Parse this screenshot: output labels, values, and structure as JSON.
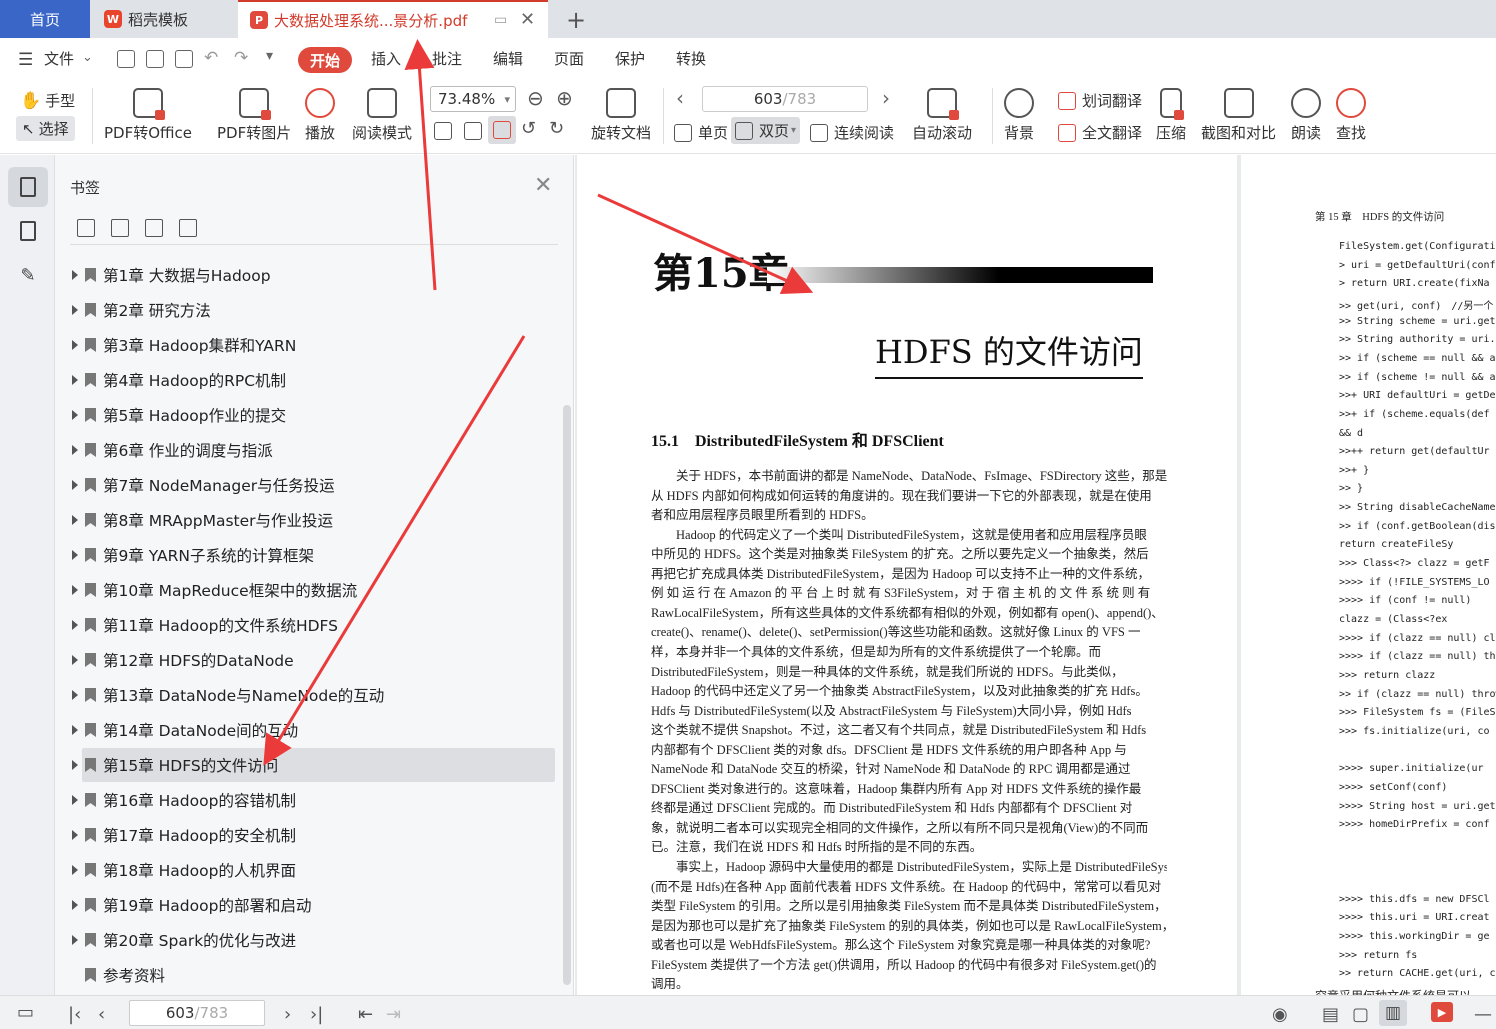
{
  "tabs": {
    "home": "首页",
    "wps": "稻壳模板",
    "pdf": "大数据处理系统...景分析.pdf"
  },
  "menu": {
    "file": "文件",
    "items": [
      "开始",
      "插入",
      "批注",
      "编辑",
      "页面",
      "保护",
      "转换"
    ]
  },
  "toolbar": {
    "hand": "手型",
    "select": "选择",
    "pdf_to_office": "PDF转Office",
    "pdf_to_image": "PDF转图片",
    "play": "播放",
    "read_mode": "阅读模式",
    "zoom": "73.48%",
    "rotate": "旋转文档",
    "page_current": "603",
    "page_total": "/783",
    "single": "单页",
    "double": "双页",
    "continuous": "连续阅读",
    "auto_scroll": "自动滚动",
    "background": "背景",
    "word_translate": "划词翻译",
    "full_translate": "全文翻译",
    "compress": "压缩",
    "screenshot": "截图和对比",
    "read_aloud": "朗读",
    "find": "查找"
  },
  "bookmarks": {
    "title": "书签",
    "items": [
      "第1章 大数据与Hadoop",
      "第2章 研究方法",
      "第3章 Hadoop集群和YARN",
      "第4章 Hadoop的RPC机制",
      "第5章 Hadoop作业的提交",
      "第6章 作业的调度与指派",
      "第7章 NodeManager与任务投运",
      "第8章 MRAppMaster与作业投运",
      "第9章 YARN子系统的计算框架",
      "第10章 MapReduce框架中的数据流",
      "第11章 Hadoop的文件系统HDFS",
      "第12章 HDFS的DataNode",
      "第13章 DataNode与NameNode的互动",
      "第14章 DataNode间的互动",
      "第15章 HDFS的文件访问",
      "第16章 Hadoop的容错机制",
      "第17章 Hadoop的安全机制",
      "第18章 Hadoop的人机界面",
      "第19章 Hadoop的部署和启动",
      "第20章 Spark的优化与改进",
      "参考资料"
    ],
    "selected_index": 14
  },
  "page1": {
    "chapter": "第15章",
    "title": "HDFS 的文件访问",
    "section": "15.1　DistributedFileSystem 和 DFSClient",
    "lines": [
      "　　关于 HDFS，本书前面讲的都是 NameNode、DataNode、FsImage、FSDirectory 这些，那是",
      "从 HDFS 内部如何构成如何运转的角度讲的。现在我们要讲一下它的外部表现，就是在使用",
      "者和应用层程序员眼里所看到的 HDFS。",
      "　　Hadoop 的代码定义了一个类叫 DistributedFileSystem，这就是使用者和应用层程序员眼",
      "中所见的 HDFS。这个类是对抽象类 FileSystem 的扩充。之所以要先定义一个抽象类，然后",
      "再把它扩充成具体类 DistributedFileSystem，是因为 Hadoop 可以支持不止一种的文件系统，",
      "例 如 运 行 在 Amazon 的 平 台 上 时 就 有 S3FileSystem，对 于 宿 主 机 的 文 件 系 统 则 有",
      "RawLocalFileSystem，所有这些具体的文件系统都有相似的外观，例如都有 open()、append()、",
      "create()、rename()、delete()、setPermission()等这些功能和函数。这就好像 Linux 的 VFS 一",
      "样，本身并非一个具体的文件系统，但是却为所有的文件系统提供了一个轮廓。而",
      "DistributedFileSystem，则是一种具体的文件系统，就是我们所说的 HDFS。与此类似，",
      "Hadoop 的代码中还定义了另一个抽象类 AbstractFileSystem，以及对此抽象类的扩充 Hdfs。",
      "Hdfs 与 DistributedFileSystem(以及 AbstractFileSystem 与 FileSystem)大同小异，例如 Hdfs",
      "这个类就不提供 Snapshot。不过，这二者又有个共同点，就是 DistributedFileSystem 和 Hdfs",
      "内部都有个 DFSClient 类的对象 dfs。DFSClient 是 HDFS 文件系统的用户即各种 App 与",
      "NameNode 和 DataNode 交互的桥梁，针对 NameNode 和 DataNode 的 RPC 调用都是通过",
      "DFSClient 类对象进行的。这意味着，Hadoop 集群内所有 App 对 HDFS 文件系统的操作最",
      "终都是通过 DFSClient 完成的。而 DistributedFileSystem 和 Hdfs 内部都有个 DFSClient 对",
      "象，就说明二者本可以实现完全相同的文件操作，之所以有所不同只是视角(View)的不同而",
      "已。注意，我们在说 HDFS 和 Hdfs 时所指的是不同的东西。",
      "　　事实上，Hadoop 源码中大量使用的都是 DistributedFileSystem，实际上是 DistributedFileSystem",
      "(而不是 Hdfs)在各种 App 面前代表着 HDFS 文件系统。在 Hadoop 的代码中，常常可以看见对",
      "类型 FileSystem 的引用。之所以是引用抽象类 FileSystem 而不是具体类 DistributedFileSystem，",
      "是因为那也可以是扩充了抽象类 FileSystem 的别的具体类，例如也可以是 RawLocalFileSystem，",
      "或者也可以是 WebHdfsFileSystem。那么这个 FileSystem 对象究竟是哪一种具体类的对象呢?",
      "FileSystem 类提供了一个方法 get()供调用，所以 Hadoop 的代码中有很多对 FileSystem.get()的",
      "调用。"
    ]
  },
  "page2": {
    "header": "第 15 章　HDFS 的文件访问",
    "code": [
      "FileSystem.get(Configuration",
      "> uri = getDefaultUri(conf)",
      "> return URI.create(fixNa",
      ">> get(uri, conf)　//另一个",
      ">> String scheme = uri.getS",
      ">> String authority = uri.g",
      ">> if (scheme == null && au",
      ">> if (scheme != null && aut",
      ">>+ URI defaultUri = getDe",
      ">>+ if (scheme.equals(def",
      "                      && d",
      ">>++ return get(defaultUr",
      ">>+ }",
      ">> }",
      ">> String disableCacheName",
      ">> if (conf.getBoolean(dis",
      "       return createFileSy",
      ">>> Class<?> clazz = getF",
      ">>>> if (!FILE_SYSTEMS_LO",
      ">>>> if (conf != null)",
      "        clazz = (Class<?ex",
      ">>>> if (clazz == null) cl",
      ">>>> if (clazz == null) th",
      ">>> return clazz",
      ">> if (clazz == null) throw",
      ">>> FileSystem fs = (FileSys",
      ">>> fs.initialize(uri, co",
      "",
      ">>>> super.initialize(ur",
      ">>>> setConf(conf)",
      ">>>> String host = uri.get",
      ">>>> homeDirPrefix = conf",
      "",
      "",
      "",
      ">>>> this.dfs = new DFSCl",
      ">>>> this.uri = URI.creat",
      ">>>> this.workingDir = ge",
      ">>> return fs",
      ">> return CACHE.get(uri, co",
      "究竟采用何种文件系统是可以"
    ]
  },
  "statusbar": {
    "page_current": "603",
    "page_total": "/783"
  },
  "colors": {
    "accent_red": "#e04a3c",
    "home_tab": "#3a66c8",
    "annotation_arrow": "#ea3a3a"
  }
}
